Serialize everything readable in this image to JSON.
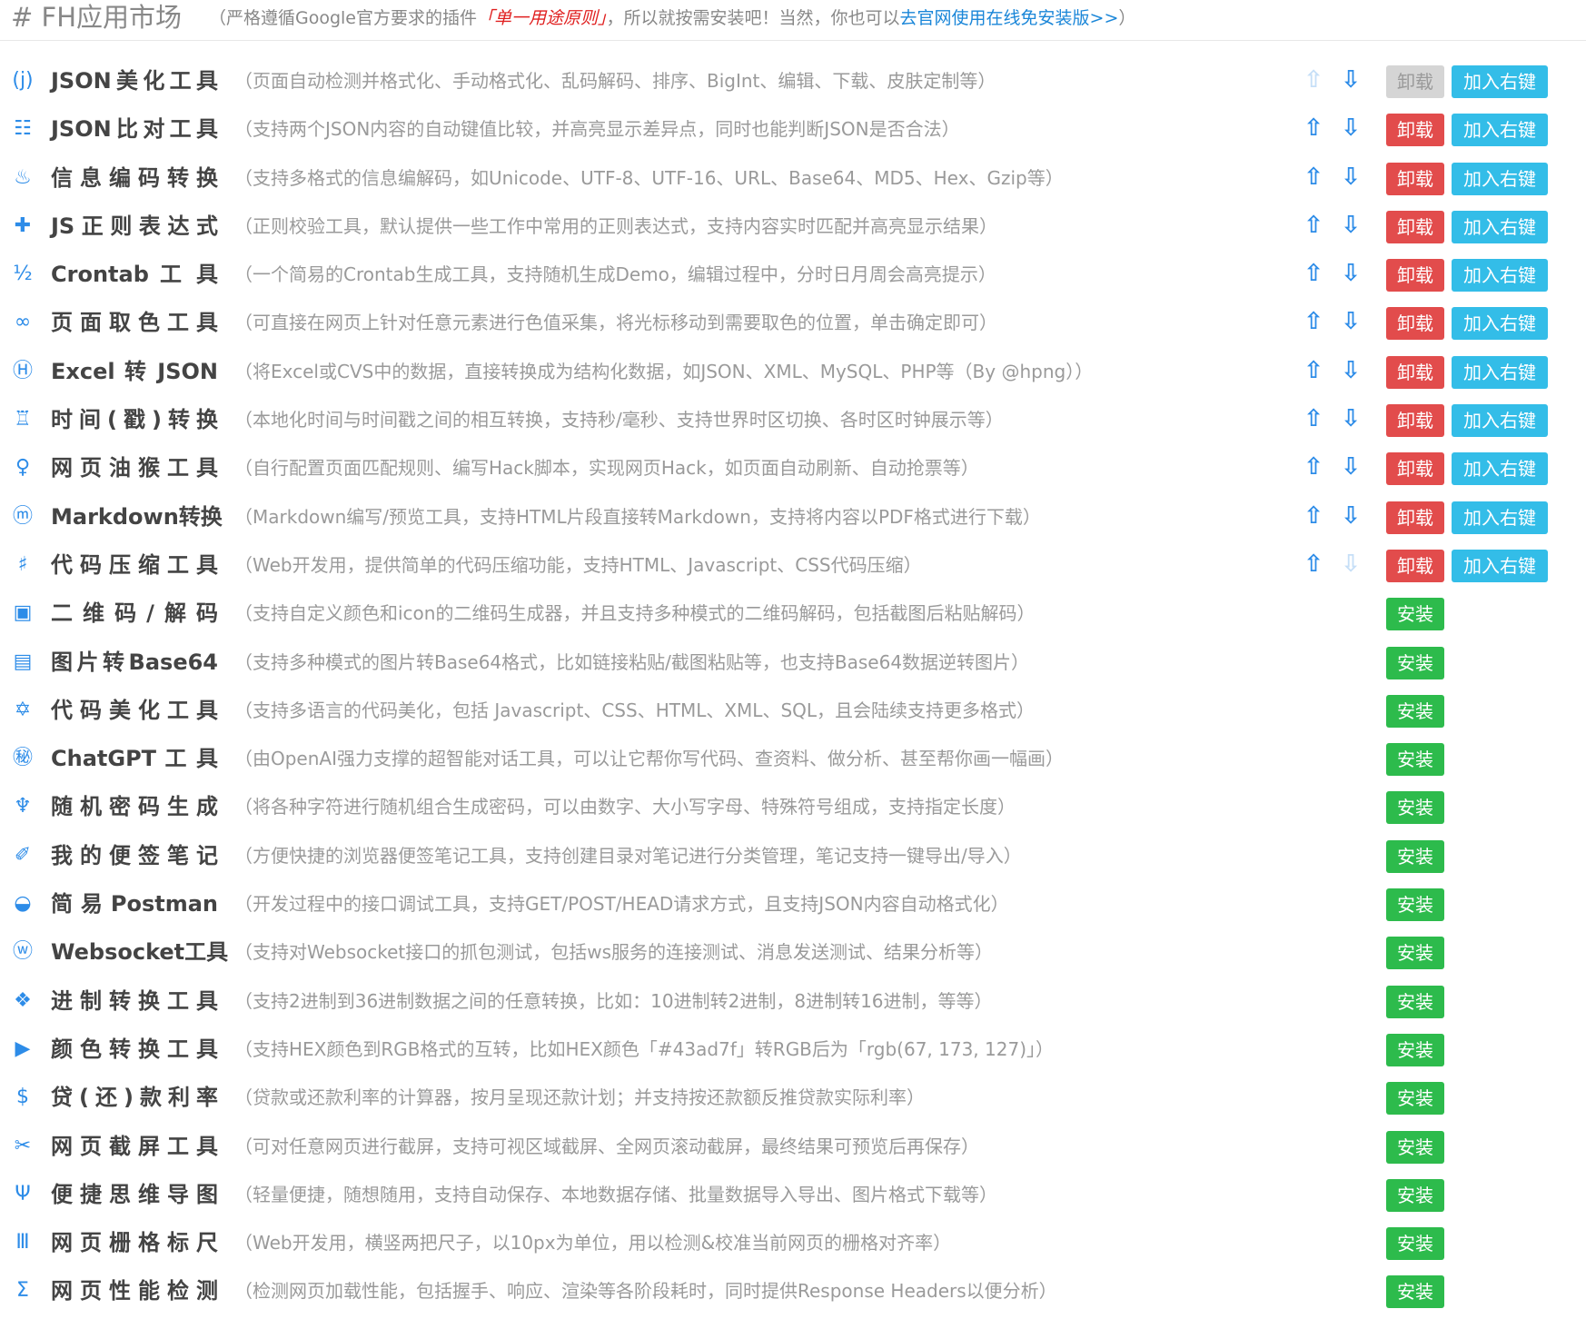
{
  "header": {
    "title": "# FH应用市场",
    "note_prefix": "（严格遵循Google官方要求的插件",
    "note_em": "「单一用途原则」",
    "note_mid": "，所以就按需安装吧！当然，你也可以",
    "note_link": "去官网使用在线免安装版>>",
    "note_suffix": "）"
  },
  "labels": {
    "uninstall": "卸载",
    "add_context": "加入右键",
    "install": "安装",
    "up_arrow": "⇧",
    "down_arrow": "⇩"
  },
  "colors": {
    "accent": "#2d8ce8",
    "uninstall": "#e24c4c",
    "context": "#33bde8",
    "install": "#2dbb4c"
  },
  "tools": [
    {
      "icon": "(j)",
      "icon_name": "json-icon",
      "name": "JSON美化工具",
      "desc": "（页面自动检测并格式化、手动格式化、乱码解码、排序、BigInt、编辑、下载、皮肤定制等）",
      "installed": true,
      "up_enabled": false,
      "down_enabled": true,
      "uninstall_enabled": false
    },
    {
      "icon": "☷",
      "icon_name": "compare-icon",
      "name": "JSON比对工具",
      "desc": "（支持两个JSON内容的自动键值比较，并高亮显示差异点，同时也能判断JSON是否合法）",
      "installed": true,
      "up_enabled": true,
      "down_enabled": true,
      "uninstall_enabled": true
    },
    {
      "icon": "♨",
      "icon_name": "encode-icon",
      "name": "信息编码转换",
      "desc": "（支持多格式的信息编解码，如Unicode、UTF-8、UTF-16、URL、Base64、MD5、Hex、Gzip等）",
      "installed": true,
      "up_enabled": true,
      "down_enabled": true,
      "uninstall_enabled": true
    },
    {
      "icon": "✚",
      "icon_name": "regex-icon",
      "name": "JS正则表达式",
      "desc": "（正则校验工具，默认提供一些工作中常用的正则表达式，支持内容实时匹配并高亮显示结果）",
      "installed": true,
      "up_enabled": true,
      "down_enabled": true,
      "uninstall_enabled": true
    },
    {
      "icon": "½",
      "icon_name": "crontab-icon",
      "name": "Crontab 工 具",
      "desc": "（一个简易的Crontab生成工具，支持随机生成Demo，编辑过程中，分时日月周会高亮提示）",
      "installed": true,
      "up_enabled": true,
      "down_enabled": true,
      "uninstall_enabled": true
    },
    {
      "icon": "∞",
      "icon_name": "color-picker-icon",
      "name": "页面取色工具",
      "desc": "（可直接在网页上针对任意元素进行色值采集，将光标移动到需要取色的位置，单击确定即可）",
      "installed": true,
      "up_enabled": true,
      "down_enabled": true,
      "uninstall_enabled": true
    },
    {
      "icon": "Ⓗ",
      "icon_name": "excel-icon",
      "name": "Excel 转 JSON",
      "desc": "（将Excel或CVS中的数据，直接转换成为结构化数据，如JSON、XML、MySQL、PHP等（By @hpng））",
      "installed": true,
      "up_enabled": true,
      "down_enabled": true,
      "uninstall_enabled": true
    },
    {
      "icon": "♖",
      "icon_name": "timestamp-icon",
      "name": "时间(戳)转换",
      "desc": "（本地化时间与时间戳之间的相互转换，支持秒/毫秒、支持世界时区切换、各时区时钟展示等）",
      "installed": true,
      "up_enabled": true,
      "down_enabled": true,
      "uninstall_enabled": true
    },
    {
      "icon": "♀",
      "icon_name": "monkey-icon",
      "name": "网页油猴工具",
      "desc": "（自行配置页面匹配规则、编写Hack脚本，实现网页Hack，如页面自动刷新、自动抢票等）",
      "installed": true,
      "up_enabled": true,
      "down_enabled": true,
      "uninstall_enabled": true
    },
    {
      "icon": "ⓜ",
      "icon_name": "markdown-icon",
      "name": "Markdown转换",
      "desc": "（Markdown编写/预览工具，支持HTML片段直接转Markdown，支持将内容以PDF格式进行下载）",
      "installed": true,
      "up_enabled": true,
      "down_enabled": true,
      "uninstall_enabled": true
    },
    {
      "icon": "♯",
      "icon_name": "compress-icon",
      "name": "代码压缩工具",
      "desc": "（Web开发用，提供简单的代码压缩功能，支持HTML、Javascript、CSS代码压缩）",
      "installed": true,
      "up_enabled": true,
      "down_enabled": false,
      "uninstall_enabled": true
    },
    {
      "icon": "▣",
      "icon_name": "qrcode-icon",
      "name": "二维码/解码",
      "desc": "（支持自定义颜色和icon的二维码生成器，并且支持多种模式的二维码解码，包括截图后粘贴解码）",
      "installed": false
    },
    {
      "icon": "▤",
      "icon_name": "image-base64-icon",
      "name": "图片转Base64",
      "desc": "（支持多种模式的图片转Base64格式，比如链接粘贴/截图粘贴等，也支持Base64数据逆转图片）",
      "installed": false
    },
    {
      "icon": "✡",
      "icon_name": "code-beautify-icon",
      "name": "代码美化工具",
      "desc": "（支持多语言的代码美化，包括 Javascript、CSS、HTML、XML、SQL，且会陆续支持更多格式）",
      "installed": false
    },
    {
      "icon": "㊙",
      "icon_name": "chatgpt-icon",
      "name": "ChatGPT 工 具",
      "desc": "（由OpenAI强力支撑的超智能对话工具，可以让它帮你写代码、查资料、做分析、甚至帮你画一幅画）",
      "installed": false
    },
    {
      "icon": "♆",
      "icon_name": "password-icon",
      "name": "随机密码生成",
      "desc": "（将各种字符进行随机组合生成密码，可以由数字、大小写字母、特殊符号组成，支持指定长度）",
      "installed": false
    },
    {
      "icon": "✐",
      "icon_name": "notes-icon",
      "name": "我的便签笔记",
      "desc": "（方便快捷的浏览器便签笔记工具，支持创建目录对笔记进行分类管理，笔记支持一键导出/导入）",
      "installed": false
    },
    {
      "icon": "◒",
      "icon_name": "postman-icon",
      "name": "简 易 Postman",
      "desc": "（开发过程中的接口调试工具，支持GET/POST/HEAD请求方式，且支持JSON内容自动格式化）",
      "installed": false
    },
    {
      "icon": "ⓦ",
      "icon_name": "websocket-icon",
      "name": "Websocket工具",
      "desc": "（支持对Websocket接口的抓包测试，包括ws服务的连接测试、消息发送测试、结果分析等）",
      "installed": false
    },
    {
      "icon": "❖",
      "icon_name": "radix-icon",
      "name": "进制转换工具",
      "desc": "（支持2进制到36进制数据之间的任意转换，比如：10进制转2进制，8进制转16进制，等等）",
      "installed": false
    },
    {
      "icon": "▶",
      "icon_name": "color-convert-icon",
      "name": "颜色转换工具",
      "desc": "（支持HEX颜色到RGB格式的互转，比如HEX颜色「#43ad7f」转RGB后为「rgb(67, 173, 127)」）",
      "installed": false
    },
    {
      "icon": "$",
      "icon_name": "loan-icon",
      "name": "贷(还)款利率",
      "desc": "（贷款或还款利率的计算器，按月呈现还款计划；并支持按还款额反推贷款实际利率）",
      "installed": false
    },
    {
      "icon": "✂",
      "icon_name": "screenshot-icon",
      "name": "网页截屏工具",
      "desc": "（可对任意网页进行截屏，支持可视区域截屏、全网页滚动截屏，最终结果可预览后再保存）",
      "installed": false
    },
    {
      "icon": "Ψ",
      "icon_name": "mindmap-icon",
      "name": "便捷思维导图",
      "desc": "（轻量便捷，随想随用，支持自动保存、本地数据存储、批量数据导入导出、图片格式下载等）",
      "installed": false
    },
    {
      "icon": "Ⅲ",
      "icon_name": "grid-ruler-icon",
      "name": "网页栅格标尺",
      "desc": "（Web开发用，横竖两把尺子，以10px为单位，用以检测&校准当前网页的栅格对齐率）",
      "installed": false
    },
    {
      "icon": "Σ",
      "icon_name": "performance-icon",
      "name": "网页性能检测",
      "desc": "（检测网页加载性能，包括握手、响应、渲染等各阶段耗时，同时提供Response Headers以便分析）",
      "installed": false
    }
  ]
}
